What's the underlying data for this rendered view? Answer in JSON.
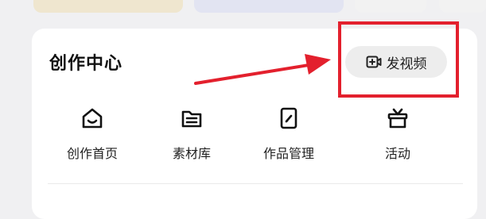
{
  "panel": {
    "title": "创作中心",
    "publish_button": {
      "label": "发视频",
      "icon": "video-add-icon"
    }
  },
  "shortcuts": [
    {
      "label": "创作首页",
      "icon": "home-icon"
    },
    {
      "label": "素材库",
      "icon": "folder-icon"
    },
    {
      "label": "作品管理",
      "icon": "edit-icon"
    },
    {
      "label": "活动",
      "icon": "gift-icon"
    }
  ],
  "annotations": {
    "highlight_color": "#e3202d"
  }
}
